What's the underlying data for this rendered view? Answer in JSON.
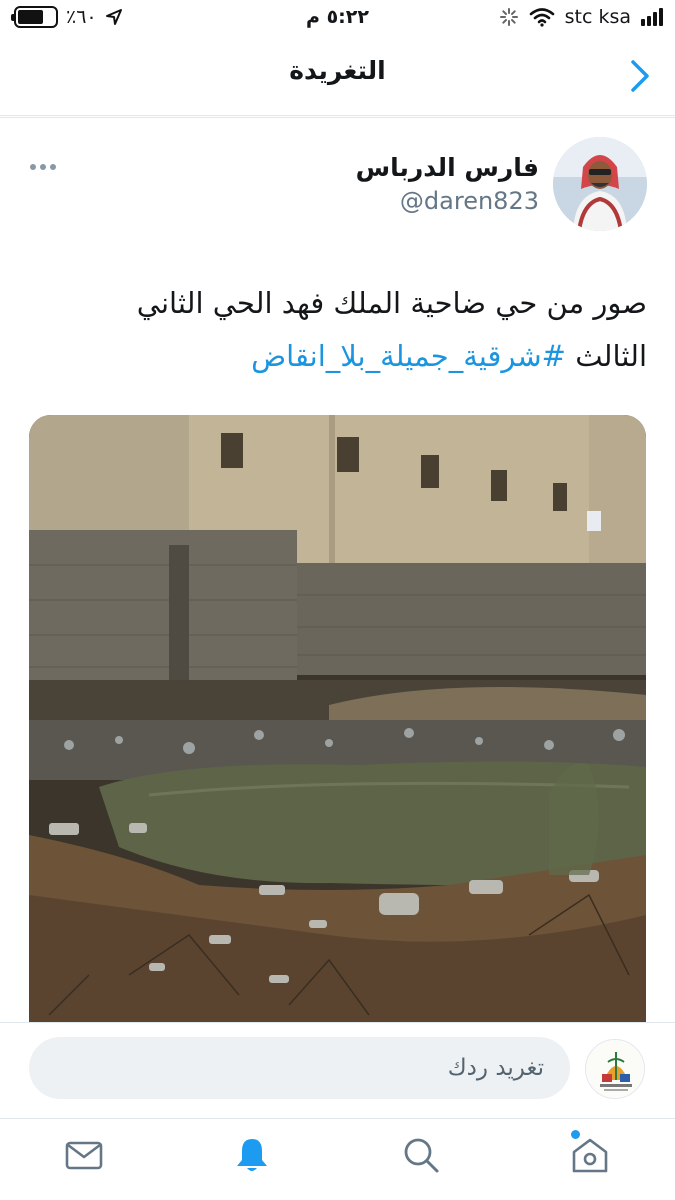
{
  "status_bar": {
    "battery": "٪٦٠",
    "time": "٥:٢٢ م",
    "carrier": "stc ksa"
  },
  "header": {
    "title": "التغريدة"
  },
  "tweet": {
    "author_name": "فارس الدرباس",
    "author_handle": "@daren823",
    "text_line1": "صور من حي ضاحية الملك فهد الحي الثاني",
    "text_line2_prefix": "الثالث",
    "hashtag": "#شرقية_جميلة_بلا_انقاض"
  },
  "reply": {
    "placeholder": "تغريد ردك"
  },
  "colors": {
    "accent": "#1d9bf0",
    "hashtag": "#1b95e0",
    "secondary_text": "#657786"
  },
  "tabs": [
    "mail-icon",
    "bell-icon",
    "search-icon",
    "home-icon"
  ]
}
